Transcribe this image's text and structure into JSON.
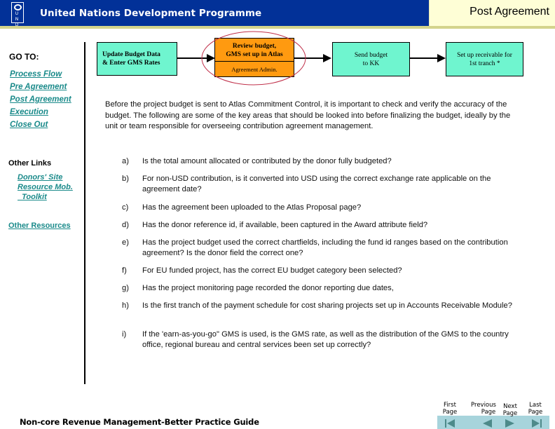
{
  "header": {
    "logo_letters": "U N D P",
    "org_name": "United Nations Development Programme",
    "page_title": "Post Agreement"
  },
  "colors": {
    "header_blue": "#023198",
    "stripe": "#d4d48c",
    "title_bg": "#fefed6",
    "link_teal": "#1a8a8a",
    "flow_teal": "#6ff5cf",
    "flow_orange": "#ff9a10",
    "highlight_ellipse": "#c0304a",
    "nav_bar": "#a7d4dc"
  },
  "sidebar": {
    "goto_label": "GO TO:",
    "nav_links": [
      "Process Flow",
      "Pre Agreement",
      "Post Agreement",
      "Execution",
      "Close Out"
    ],
    "other_links_label": "Other Links",
    "other_links": [
      "Donors' Site",
      "Resource Mob.",
      "  Toolkit"
    ],
    "other_resources": "Other Resources"
  },
  "flowchart": {
    "steps": [
      {
        "line1": "Update Budget Data",
        "line2": "& Enter GMS Rates"
      },
      {
        "line1": "Review budget,",
        "line2": "GMS set up in Atlas",
        "sub": "Agreement Admin.",
        "highlighted": true
      },
      {
        "line1": "Send budget",
        "line2": "to KK"
      },
      {
        "line1": "Set up receivable for",
        "line2": "1st tranch *"
      }
    ]
  },
  "content": {
    "intro": "Before the project budget is sent to Atlas Commitment Control, it is important to check and verify the accuracy of the budget.  The following are some of the key areas that should be looked into before finalizing the budget, ideally by the unit or team responsible for overseeing contribution agreement management.",
    "questions": [
      {
        "letter": "a)",
        "text": "Is the total amount allocated or contributed by the donor fully budgeted?"
      },
      {
        "letter": "b)",
        "text": "For non-USD contribution, is it converted into USD using the correct exchange rate applicable on the agreement date?"
      },
      {
        "letter": "c)",
        "text": "Has the agreement been uploaded to the Atlas Proposal page?"
      },
      {
        "letter": "d)",
        "text": "Has the donor reference id, if available, been captured in the Award attribute field?"
      },
      {
        "letter": "e)",
        "text": "Has the project budget used the correct chartfields, including the fund id ranges based on the contribution agreement?  Is the donor field the correct one?"
      },
      {
        "letter": "f)",
        "text": "For EU funded project, has the correct EU budget category been selected?"
      },
      {
        "letter": "g)",
        "text": "Has the project monitoring page recorded the donor reporting due dates,"
      },
      {
        "letter": "h)",
        "text": "Is the first tranch of the payment schedule for cost sharing projects set up in Accounts Receivable Module?"
      },
      {
        "letter": "i)",
        "text": "If the 'earn-as-you-go\" GMS is used, is the GMS rate, as well as the distribution of the GMS to the country office, regional bureau and central services been set up correctly?"
      }
    ]
  },
  "footer": {
    "title": "Non-core Revenue Management-Better Practice Guide",
    "nav": {
      "first": [
        "First",
        "Page"
      ],
      "previous": [
        "Previous",
        "Page"
      ],
      "next": [
        "Next",
        "Page"
      ],
      "last": [
        "Last",
        "Page"
      ]
    }
  }
}
